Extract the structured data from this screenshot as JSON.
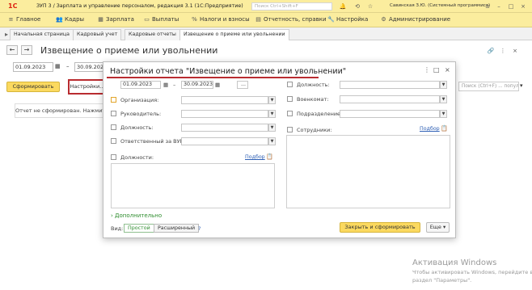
{
  "titlebar": {
    "logo": "1С",
    "title": "ЗУП 3 / Зарплата и управление персоналом, редакция 3.1  (1С:Предприятие)",
    "search_placeholder": "Поиск Ctrl+Shift+F",
    "user": "Савинская З.Ю. (Системный программист)"
  },
  "menu": {
    "items": [
      {
        "label": "Главное",
        "icon": "menu-icon"
      },
      {
        "label": "Кадры",
        "icon": "people-icon"
      },
      {
        "label": "Зарплата",
        "icon": "calculator-icon"
      },
      {
        "label": "Выплаты",
        "icon": "wallet-icon"
      },
      {
        "label": "Налоги и взносы",
        "icon": "percent-icon"
      },
      {
        "label": "Отчетность, справки",
        "icon": "report-icon"
      },
      {
        "label": "Настройка",
        "icon": "wrench-icon"
      },
      {
        "label": "Администрирование",
        "icon": "gear-icon"
      }
    ]
  },
  "tabs": [
    "Начальная страница",
    "Кадровый учет",
    "Кадровые отчеты",
    "Извещение о приеме или увольнении"
  ],
  "page": {
    "title": "Извещение о приеме или увольнении",
    "date_from": "01.09.2023",
    "date_to": "30.09.2023",
    "generate_label": "Сформировать",
    "settings_label": "Настройки...",
    "not_formed": "Отчет не сформирован. Нажмите",
    "right_search": "Поиск (Ctrl+F) ... популятия в пр. )"
  },
  "dialog": {
    "title": "Настройки отчета \"Извещение о приеме или увольнении\"",
    "date_from": "01.09.2023",
    "date_to": "30.09.2023",
    "dots": "...",
    "left_fields": [
      "Организация:",
      "Руководитель:",
      "Должность:",
      "Ответственный за ВУР:"
    ],
    "right_fields": [
      "Должность:",
      "Военкомат:",
      "Подразделение:"
    ],
    "positions_label": "Должности:",
    "staff_label": "Сотрудники:",
    "selection_link": "Подбор",
    "more_label": "Дополнительно",
    "view_label": "Вид:",
    "view_simple": "Простой",
    "view_advanced": "Расширенный",
    "help": "?",
    "close_generate": "Закрыть и сформировать",
    "more_btn": "Еще"
  },
  "watermark": {
    "line1": "Активация Windows",
    "line2": "Чтобы активировать Windows, перейдите в",
    "line3": "раздел \"Параметры\"."
  }
}
